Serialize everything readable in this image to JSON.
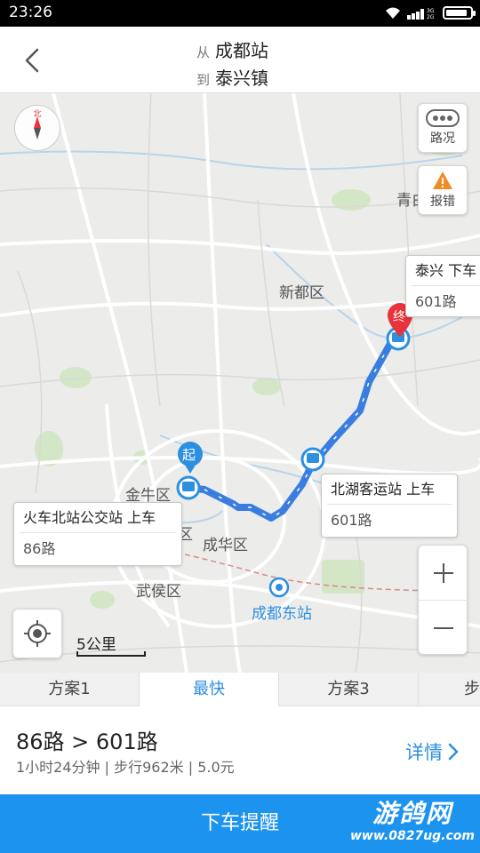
{
  "status_bar": {
    "time": "23:26",
    "battery_level": 0.9
  },
  "header": {
    "from_prefix": "从",
    "from_place": "成都站",
    "to_prefix": "到",
    "to_place": "泰兴镇"
  },
  "map": {
    "compass_letter": "北",
    "traffic_label": "路况",
    "report_label": "报错",
    "districts": {
      "xindu": "新都区",
      "jinniu": "金牛区",
      "chenghua": "成华区",
      "wuhou": "武侯区",
      "qingbai": "青白",
      "qu_fragment": "区"
    },
    "station_label": "成都东站",
    "start_badge": "起",
    "end_badge": "终",
    "callouts": {
      "board_start": {
        "title": "火车北站公交站 上车",
        "line": "86路"
      },
      "transfer": {
        "title": "北湖客运站 上车",
        "line": "601路"
      },
      "alight": {
        "title": "泰兴 下车",
        "line": "601路"
      }
    },
    "scale_label": "5公里"
  },
  "tabs": [
    {
      "label": "方案1"
    },
    {
      "label": "最快"
    },
    {
      "label": "方案3"
    },
    {
      "label": "步"
    }
  ],
  "plan": {
    "title": "86路 > 601路",
    "meta": "1小时24分钟 | 步行962米 | 5.0元",
    "details_label": "详情"
  },
  "bottom": {
    "alert_label": "下车提醒",
    "watermark_main": "游鸽网",
    "watermark_url": "www.0827ug.com"
  },
  "colors": {
    "accent": "#2d8fe0",
    "route": "#3a7de0",
    "start_marker": "#2d8fe0",
    "end_marker": "#e8323c",
    "bottom_bar": "#1c93ee"
  }
}
